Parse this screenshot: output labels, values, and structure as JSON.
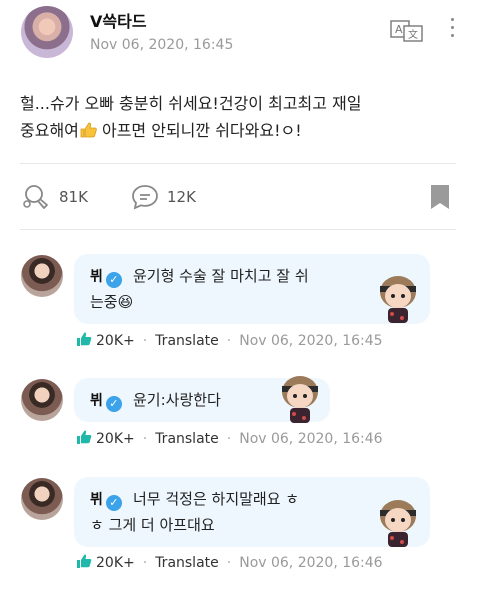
{
  "post": {
    "username": "V쓱타드",
    "date": "Nov 06, 2020, 16:45",
    "text_line1": "헐...슈가 오빠 충분히 쉬세요!건강이 최고최고 재일",
    "text_line2_a": "중요해여",
    "text_line2_b": " 아프면 안되니깐 쉬다와요!ㅇ!",
    "likes": "81K",
    "comments": "12K"
  },
  "replies": [
    {
      "name": "뷔",
      "text_line1": "윤기형 수술 잘 마치고 잘 쉬",
      "text_line2": "는중😆",
      "likes": "20K+",
      "translate": "Translate",
      "date": "Nov 06, 2020, 16:45"
    },
    {
      "name": "뷔",
      "text_line1": "윤기:사랑한다",
      "likes": "20K+",
      "translate": "Translate",
      "date": "Nov 06, 2020, 16:46"
    },
    {
      "name": "뷔",
      "text_line1": "너무 걱정은 하지말래요 ㅎ",
      "text_line2": "ㅎ 그게 더 아프대요",
      "likes": "20K+",
      "translate": "Translate",
      "date": "Nov 06, 2020, 16:46"
    }
  ],
  "colors": {
    "bubble_bg": "#eef7fd",
    "verified": "#3ca3ea",
    "like_teal": "#1fb8a9",
    "muted": "#9a9a9a"
  },
  "icons": [
    "translate-icon",
    "more-icon",
    "like-icon",
    "comment-icon",
    "bookmark-icon",
    "verified-check-icon",
    "thumbs-up-icon"
  ]
}
